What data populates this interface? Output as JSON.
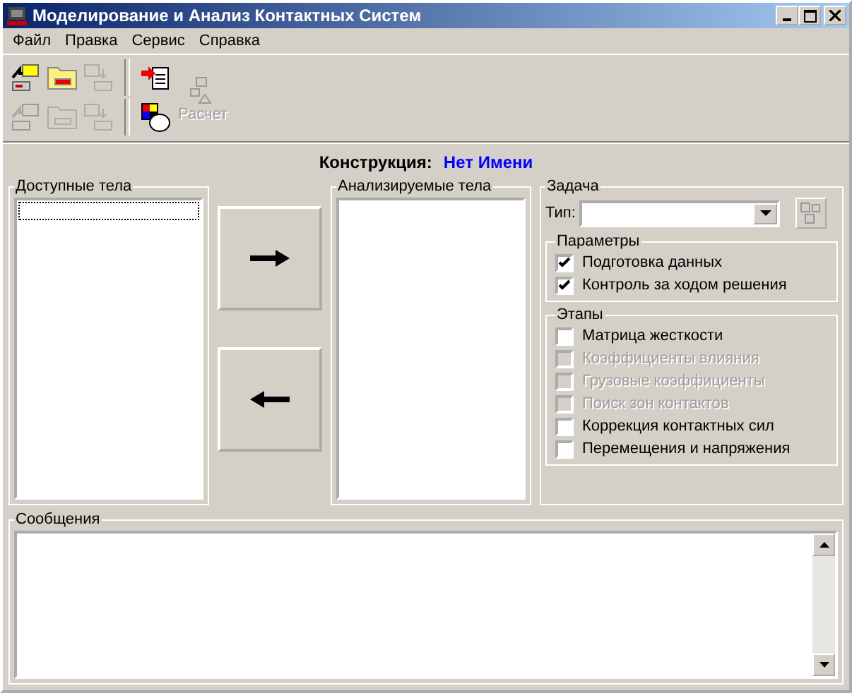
{
  "window": {
    "title": "Моделирование и Анализ Контактных Систем"
  },
  "menu": [
    "Файл",
    "Правка",
    "Сервис",
    "Справка"
  ],
  "toolbar": {
    "rows": [
      [
        {
          "kind": "open",
          "disabled": false
        },
        {
          "kind": "close",
          "disabled": false
        },
        {
          "kind": "copy",
          "disabled": true
        },
        {
          "kind": "sep"
        },
        {
          "kind": "import",
          "disabled": false
        }
      ],
      [
        {
          "kind": "open",
          "disabled": true
        },
        {
          "kind": "close",
          "disabled": true
        },
        {
          "kind": "copy",
          "disabled": true
        },
        {
          "kind": "sep"
        },
        {
          "kind": "paint",
          "disabled": false
        }
      ]
    ],
    "calc": {
      "label": "Расчет",
      "disabled": true
    }
  },
  "construction": {
    "label": "Конструкция:",
    "value": "Нет Имени"
  },
  "available": {
    "title": "Доступные тела"
  },
  "analyzed": {
    "title": "Анализируемые тела"
  },
  "task": {
    "title": "Задача",
    "type_label": "Тип:",
    "parameters": {
      "title": "Параметры",
      "items": [
        {
          "label": "Подготовка данных",
          "checked": true,
          "disabled": false
        },
        {
          "label": "Контроль за ходом решения",
          "checked": true,
          "disabled": false
        }
      ]
    },
    "stages": {
      "title": "Этапы",
      "items": [
        {
          "label": "Матрица жесткости",
          "checked": false,
          "disabled": false
        },
        {
          "label": "Коэффициенты влияния",
          "checked": false,
          "disabled": true
        },
        {
          "label": "Грузовые коэффициенты",
          "checked": false,
          "disabled": true
        },
        {
          "label": "Поиск зон контактов",
          "checked": false,
          "disabled": true
        },
        {
          "label": "Коррекция контактных сил",
          "checked": false,
          "disabled": false
        },
        {
          "label": "Перемещения и напряжения",
          "checked": false,
          "disabled": false
        }
      ]
    }
  },
  "messages": {
    "title": "Сообщения"
  }
}
